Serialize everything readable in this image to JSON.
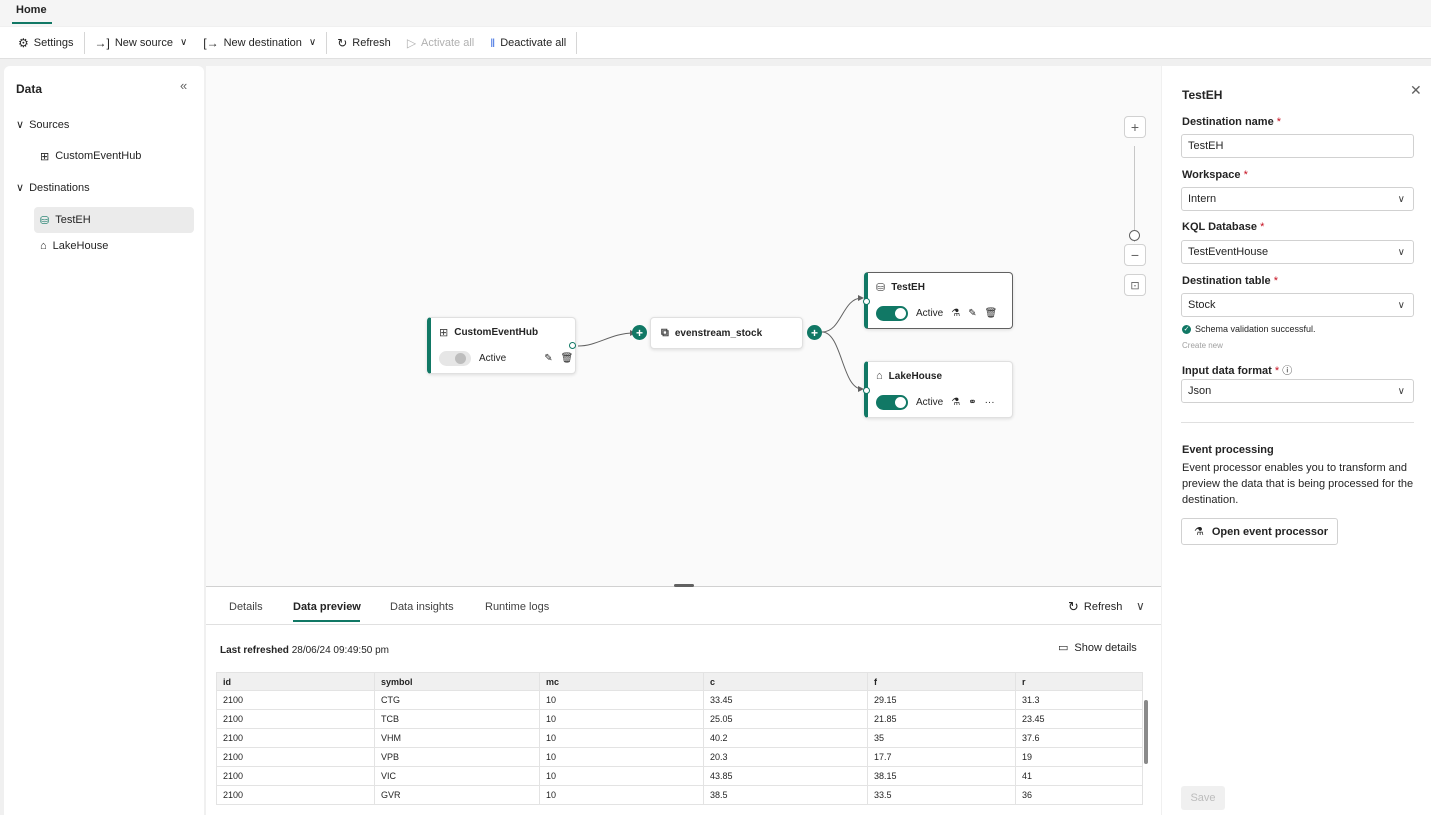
{
  "top_tabs": {
    "home": "Home"
  },
  "toolbar": {
    "settings": "Settings",
    "new_source": "New source",
    "new_destination": "New destination",
    "refresh": "Refresh",
    "activate_all": "Activate all",
    "deactivate_all": "Deactivate all"
  },
  "sidebar": {
    "title": "Data",
    "sources_label": "Sources",
    "sources": [
      "CustomEventHub"
    ],
    "destinations_label": "Destinations",
    "destinations": [
      "TestEH",
      "LakeHouse"
    ]
  },
  "canvas": {
    "source_node": {
      "title": "CustomEventHub",
      "status": "Active"
    },
    "stream_node": {
      "title": "evenstream_stock"
    },
    "dest_nodes": [
      {
        "title": "TestEH",
        "status": "Active"
      },
      {
        "title": "LakeHouse",
        "status": "Active"
      }
    ],
    "zoom": {
      "plus": "+",
      "minus": "−"
    }
  },
  "bottom": {
    "tabs": [
      "Details",
      "Data preview",
      "Data insights",
      "Runtime logs"
    ],
    "active_tab": "Data preview",
    "refresh": "Refresh",
    "last_refreshed_label": "Last refreshed",
    "last_refreshed_value": "28/06/24 09:49:50 pm",
    "show_details": "Show details",
    "columns": [
      "id",
      "symbol",
      "mc",
      "c",
      "f",
      "r"
    ],
    "rows": [
      [
        "2100",
        "CTG",
        "10",
        "33.45",
        "29.15",
        "31.3"
      ],
      [
        "2100",
        "TCB",
        "10",
        "25.05",
        "21.85",
        "23.45"
      ],
      [
        "2100",
        "VHM",
        "10",
        "40.2",
        "35",
        "37.6"
      ],
      [
        "2100",
        "VPB",
        "10",
        "20.3",
        "17.7",
        "19"
      ],
      [
        "2100",
        "VIC",
        "10",
        "43.85",
        "38.15",
        "41"
      ],
      [
        "2100",
        "GVR",
        "10",
        "38.5",
        "33.5",
        "36"
      ]
    ]
  },
  "right_panel": {
    "title": "TestEH",
    "destination_name_label": "Destination name",
    "destination_name_value": "TestEH",
    "workspace_label": "Workspace",
    "workspace_value": "Intern",
    "kql_label": "KQL Database",
    "kql_value": "TestEventHouse",
    "table_label": "Destination table",
    "table_value": "Stock",
    "schema_msg": "Schema validation successful.",
    "create_new": "Create new",
    "format_label": "Input data format",
    "format_value": "Json",
    "event_processing_title": "Event processing",
    "event_processing_desc": "Event processor enables you to transform and preview the data that is being processed for the destination.",
    "open_processor": "Open event processor",
    "save": "Save",
    "required_mark": "*"
  },
  "colors": {
    "accent": "#117865"
  }
}
